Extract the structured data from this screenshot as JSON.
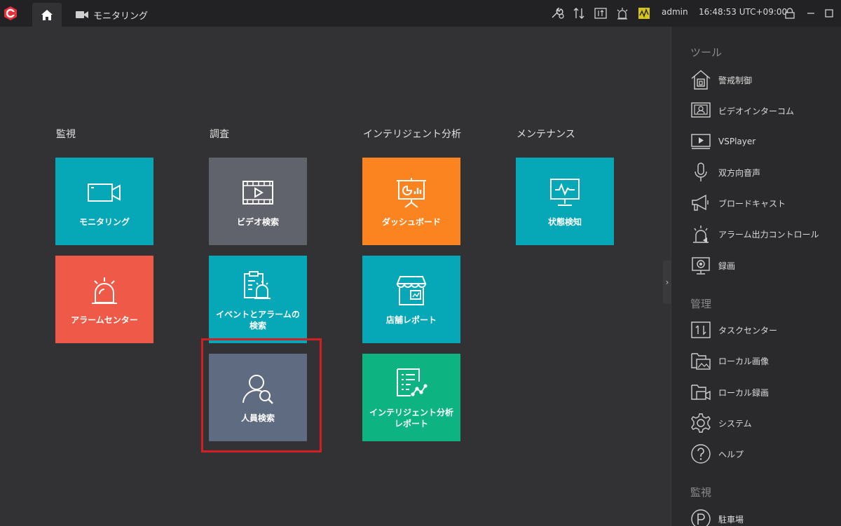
{
  "topbar": {
    "home_tab": "home-icon",
    "monitor_tab_label": "モニタリング",
    "user": "admin",
    "clock": "16:48:53 UTC+09:00"
  },
  "columns": [
    {
      "title": "監視",
      "tiles": [
        {
          "label": "モニタリング",
          "icon": "camera-icon",
          "color": "#06a8b8"
        },
        {
          "label": "アラームセンター",
          "icon": "alarm-icon",
          "color": "#ef5a48"
        }
      ]
    },
    {
      "title": "調査",
      "tiles": [
        {
          "label": "ビデオ検索",
          "icon": "video-search-icon",
          "color": "#60636b"
        },
        {
          "label": "イベントとアラームの検索",
          "icon": "event-search-icon",
          "color": "#06a8b8"
        },
        {
          "label": "人員検索",
          "icon": "person-search-icon",
          "color": "#5f6b80"
        }
      ]
    },
    {
      "title": "インテリジェント分析",
      "tiles": [
        {
          "label": "ダッシュボード",
          "icon": "dashboard-icon",
          "color": "#fb8421"
        },
        {
          "label": "店舗レポート",
          "icon": "store-icon",
          "color": "#06a8b8"
        },
        {
          "label": "インテリジェント分析レポート",
          "icon": "report-icon",
          "color": "#0db482"
        }
      ]
    },
    {
      "title": "メンテナンス",
      "tiles": [
        {
          "label": "状態検知",
          "icon": "monitor-status-icon",
          "color": "#06a8b8"
        }
      ]
    }
  ],
  "right_panel": {
    "sections": [
      {
        "title": "ツール",
        "items": [
          {
            "label": "警戒制御"
          },
          {
            "label": "ビデオインターコム"
          },
          {
            "label": "VSPlayer"
          },
          {
            "label": "双方向音声"
          },
          {
            "label": "ブロードキャスト"
          },
          {
            "label": "アラーム出力コントロール"
          },
          {
            "label": "録画"
          }
        ]
      },
      {
        "title": "管理",
        "items": [
          {
            "label": "タスクセンター"
          },
          {
            "label": "ローカル画像"
          },
          {
            "label": "ローカル録画"
          },
          {
            "label": "システム"
          },
          {
            "label": "ヘルプ"
          }
        ]
      },
      {
        "title": "監視",
        "items": [
          {
            "label": "駐車場"
          }
        ]
      }
    ]
  }
}
